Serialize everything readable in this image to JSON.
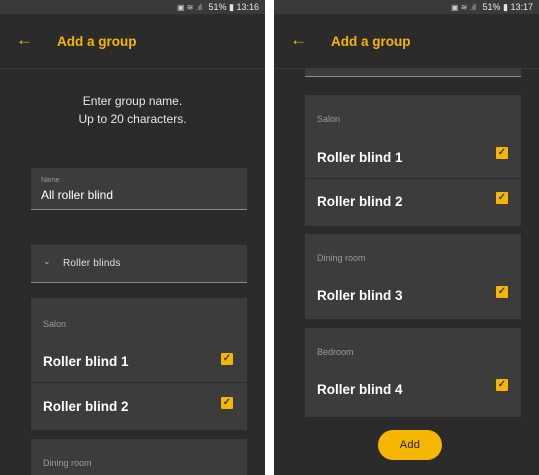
{
  "left": {
    "status": {
      "battery": "51%",
      "time": "13:16"
    },
    "title": "Add a group",
    "hint_line1": "Enter group name.",
    "hint_line2": "Up to 20 characters.",
    "name_label": "Name",
    "name_value": "All roller blind",
    "dropdown_label": "Roller blinds",
    "groups": [
      {
        "label": "Salon",
        "items": [
          "Roller blind 1",
          "Roller blind 2"
        ]
      },
      {
        "label": "Dining room"
      }
    ]
  },
  "right": {
    "status": {
      "battery": "51%",
      "time": "13:17"
    },
    "title": "Add a group",
    "groups": [
      {
        "label": "Salon",
        "items": [
          "Roller blind 1",
          "Roller blind 2"
        ]
      },
      {
        "label": "Dining room",
        "items": [
          "Roller blind 3"
        ]
      },
      {
        "label": "Bedroom",
        "items": [
          "Roller blind 4"
        ]
      }
    ],
    "add_label": "Add"
  },
  "colors": {
    "accent": "#f6b600",
    "background": "#2b2b2b",
    "card": "#3c3c3c"
  },
  "icons": {
    "back": "arrow-left-icon",
    "checkbox": "checkbox-checked-icon",
    "dropdown": "chevron-down-icon"
  }
}
